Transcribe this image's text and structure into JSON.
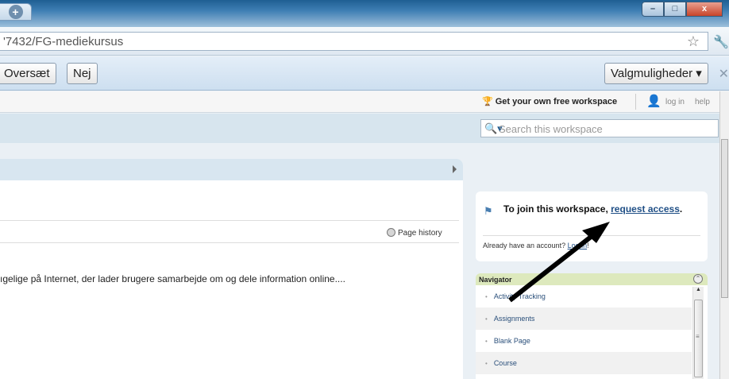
{
  "browser": {
    "new_tab_label": "+",
    "window_controls": {
      "minimize": "–",
      "maximize": "□",
      "close": "x"
    },
    "url": "'7432/FG-mediekursus",
    "bookmark_icon": "star-icon",
    "menu_icon": "wrench-icon"
  },
  "translate_bar": {
    "translate_label": "Oversæt",
    "no_label": "Nej",
    "options_label": "Valgmuligheder ▾",
    "close_label": "✕"
  },
  "top_strip": {
    "get_free": "Get your own free workspace",
    "login": "log in",
    "help": "help"
  },
  "search": {
    "placeholder": "Search this workspace"
  },
  "main": {
    "page_history": "Page history",
    "body_text": "ıgelige på Internet, der lader brugere samarbejde om og dele information online...."
  },
  "join": {
    "prefix": "To join this workspace, ",
    "link": "request access",
    "suffix": ".",
    "already_prefix": "Already have an account? ",
    "already_link": "Log in",
    "already_suffix": "!"
  },
  "navigator": {
    "title": "Navigator",
    "items": [
      "Activity Tracking",
      "Assignments",
      "Blank Page",
      "Course"
    ]
  },
  "colors": {
    "titlebar": "#3f7fb4",
    "link": "#1f4f86",
    "nav_header": "#dde9bd",
    "page_bg": "#eaf0f5"
  }
}
